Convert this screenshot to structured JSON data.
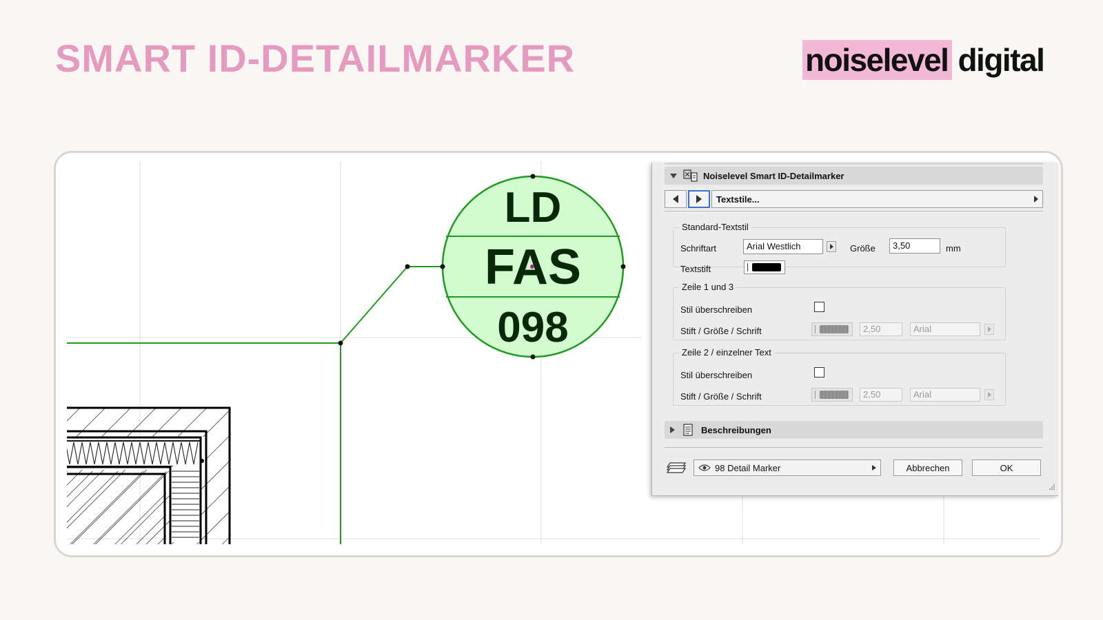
{
  "header": {
    "title": "SMART ID-DETAILMARKER",
    "logo_part1": "noiselevel",
    "logo_part2": "digital"
  },
  "marker": {
    "row1": "LD",
    "row2": "FAS",
    "row3": "098",
    "fill_color": "#d3fbd0",
    "line_color": "#1e9b1e"
  },
  "dialog": {
    "section_title": "Noiselevel Smart ID-Detailmarker",
    "nav_select": "Textstile...",
    "group_standard": {
      "title": "Standard-Textstil",
      "font_label": "Schriftart",
      "font_value": "Arial Westlich",
      "size_label": "Größe",
      "size_value": "3,50",
      "unit": "mm",
      "pen_label": "Textstift"
    },
    "group_lines13": {
      "title": "Zeile 1 und 3",
      "override_label": "Stil überschreiben",
      "pen_label": "Stift / Größe / Schrift",
      "size_value": "2,50",
      "font_value": "Arial"
    },
    "group_line2": {
      "title": "Zeile 2 / einzelner Text",
      "override_label": "Stil überschreiben",
      "pen_label": "Stift / Größe / Schrift",
      "size_value": "2,50",
      "font_value": "Arial"
    },
    "descriptions_title": "Beschreibungen",
    "layer_select": "98 Detail Marker",
    "cancel_label": "Abbrechen",
    "ok_label": "OK"
  }
}
